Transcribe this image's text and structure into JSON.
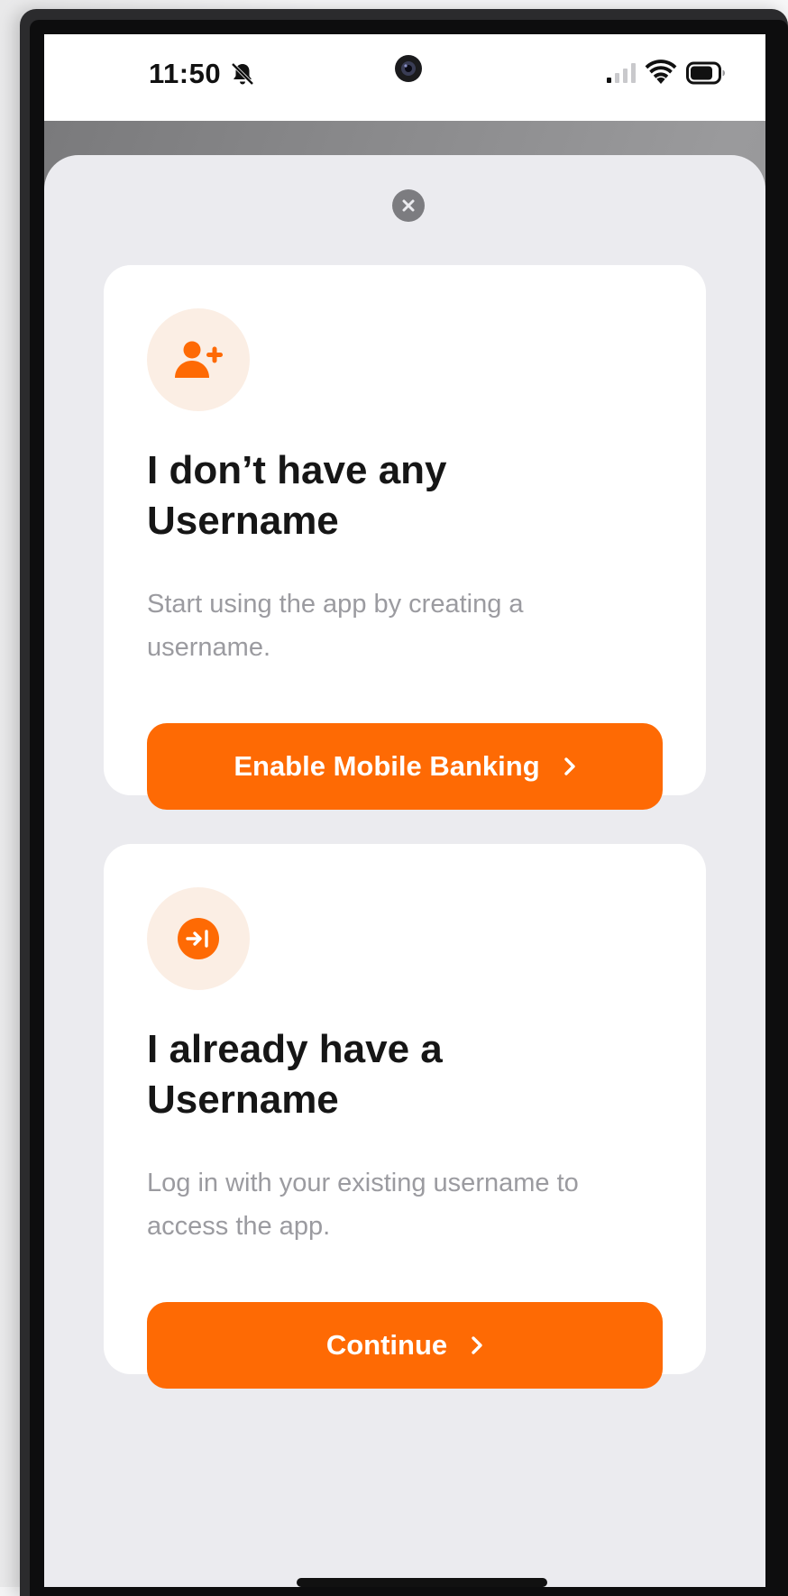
{
  "status_bar": {
    "time": "11:50",
    "icons": [
      "bell-muted-icon",
      "camera-icon",
      "signal-icon",
      "wifi-icon",
      "battery-icon"
    ]
  },
  "sheet": {
    "close_icon": "close-icon",
    "cards": [
      {
        "icon": "person-add-icon",
        "title_line1": "I don’t have any",
        "title_line2": "Username",
        "description_line1": "Start using the app by creating a",
        "description_line2": "username.",
        "button_label": "Enable Mobile Banking"
      },
      {
        "icon": "login-arrow-icon",
        "title_line1": "I already have a",
        "title_line2": "Username",
        "description_line1": "Log in with your existing username to",
        "description_line2": "access the app.",
        "button_label": "Continue"
      }
    ]
  },
  "colors": {
    "accent": "#fe6a04",
    "icon_circle_bg": "#fbeee4",
    "sheet_bg": "#ebebef",
    "title": "#161616",
    "description": "#9b9ba0"
  }
}
